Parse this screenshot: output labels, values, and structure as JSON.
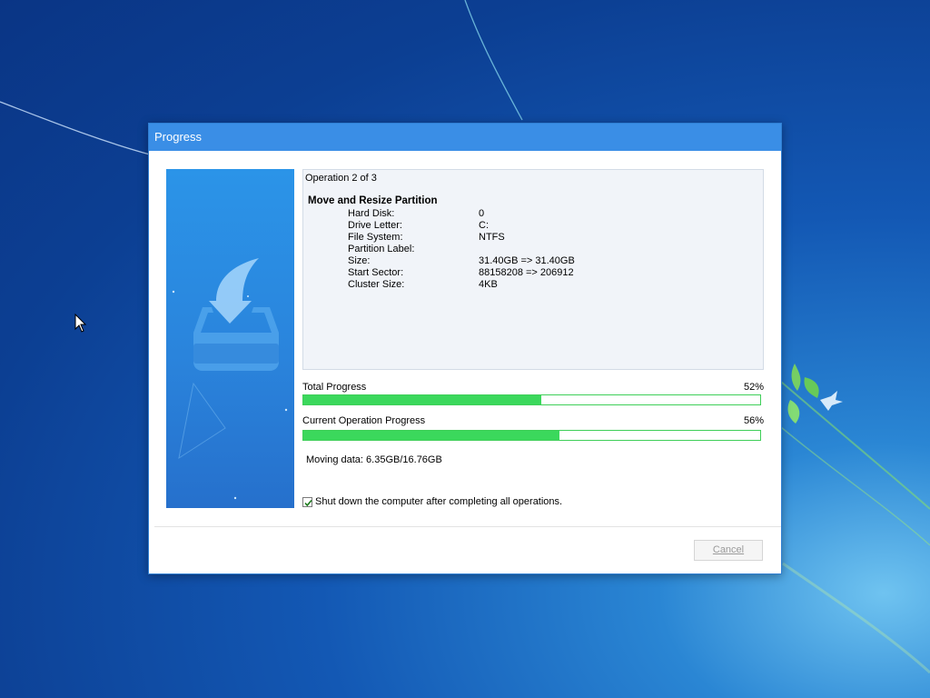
{
  "dialog": {
    "title": "Progress",
    "operation_header": "Operation 2 of 3",
    "operation_title": "Move and Resize Partition",
    "details": [
      {
        "label": "Hard Disk:",
        "value": "0"
      },
      {
        "label": "Drive Letter:",
        "value": "C:"
      },
      {
        "label": "File System:",
        "value": "NTFS"
      },
      {
        "label": "Partition Label:",
        "value": ""
      },
      {
        "label": "Size:",
        "value": "31.40GB => 31.40GB"
      },
      {
        "label": "Start Sector:",
        "value": "88158208 => 206912"
      },
      {
        "label": "Cluster Size:",
        "value": "4KB"
      }
    ],
    "total_progress": {
      "label": "Total Progress",
      "percent_text": "52%",
      "value": 52
    },
    "current_progress": {
      "label": "Current Operation Progress",
      "percent_text": "56%",
      "value": 56
    },
    "moving_data": "Moving data: 6.35GB/16.76GB",
    "shutdown_checkbox": {
      "label": "Shut down the computer after completing all operations.",
      "checked": true
    },
    "cancel_button": "Cancel"
  },
  "colors": {
    "titlebar": "#3a8ee6",
    "progress_fill": "#3bd85c",
    "banner": "#2a84dc"
  },
  "icons": [
    "download-drive-icon",
    "checkmark-icon",
    "mouse-cursor-icon"
  ]
}
